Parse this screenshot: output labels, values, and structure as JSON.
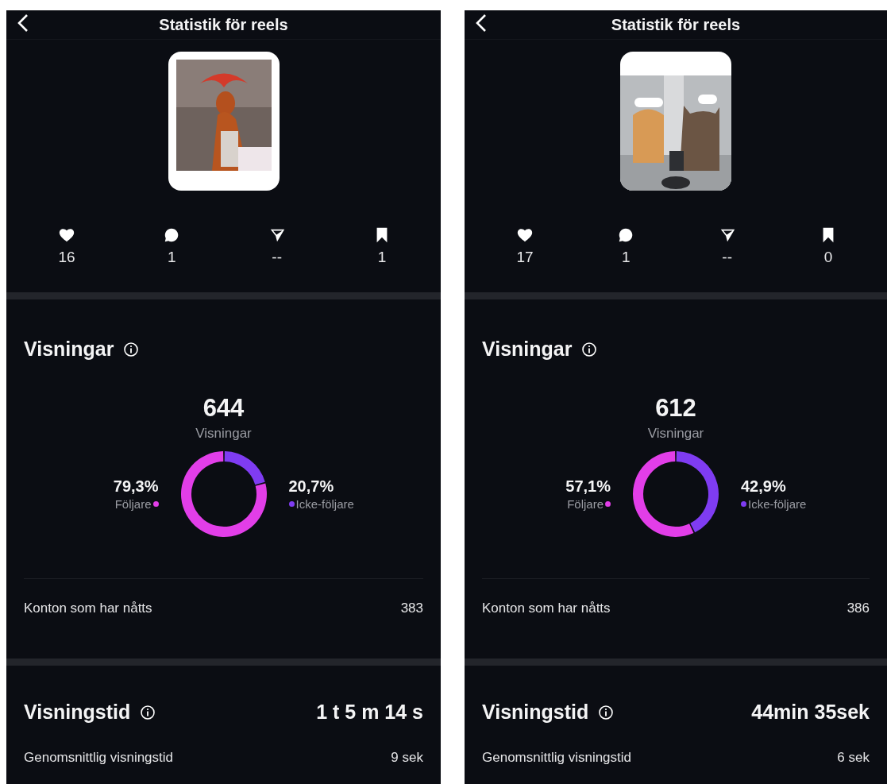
{
  "panels": [
    {
      "title": "Statistik för reels",
      "stats": [
        {
          "kind": "likes",
          "value": "16"
        },
        {
          "kind": "comments",
          "value": "1"
        },
        {
          "kind": "shares",
          "value": "--"
        },
        {
          "kind": "saves",
          "value": "1"
        }
      ],
      "views": {
        "heading": "Visningar",
        "total": "644",
        "total_label": "Visningar",
        "legend": [
          {
            "color": "#e23ee8"
          },
          {
            "color": "#7f3cf2"
          }
        ],
        "chart_data": {
          "type": "donut",
          "categories": [
            "Följare",
            "Icke-följare"
          ],
          "values": [
            79.3,
            20.7
          ],
          "value_labels": [
            "79,3%",
            "20,7%"
          ]
        }
      },
      "reached": {
        "label": "Konton som har nåtts",
        "value": "383"
      },
      "watch_time": {
        "heading": "Visningstid",
        "value": "1 t 5 m 14 s",
        "average_label": "Genomsnittlig visningstid",
        "average_value": "9 sek"
      }
    },
    {
      "title": "Statistik för reels",
      "stats": [
        {
          "kind": "likes",
          "value": "17"
        },
        {
          "kind": "comments",
          "value": "1"
        },
        {
          "kind": "shares",
          "value": "--"
        },
        {
          "kind": "saves",
          "value": "0"
        }
      ],
      "views": {
        "heading": "Visningar",
        "total": "612",
        "total_label": "Visningar",
        "legend": [
          {
            "color": "#e23ee8"
          },
          {
            "color": "#7f3cf2"
          }
        ],
        "chart_data": {
          "type": "donut",
          "categories": [
            "Följare",
            "Icke-följare"
          ],
          "values": [
            57.1,
            42.9
          ],
          "value_labels": [
            "57,1%",
            "42,9%"
          ]
        }
      },
      "reached": {
        "label": "Konton som har nåtts",
        "value": "386"
      },
      "watch_time": {
        "heading": "Visningstid",
        "value": "44min 35sek",
        "average_label": "Genomsnittlig visningstid",
        "average_value": "6 sek"
      }
    }
  ]
}
